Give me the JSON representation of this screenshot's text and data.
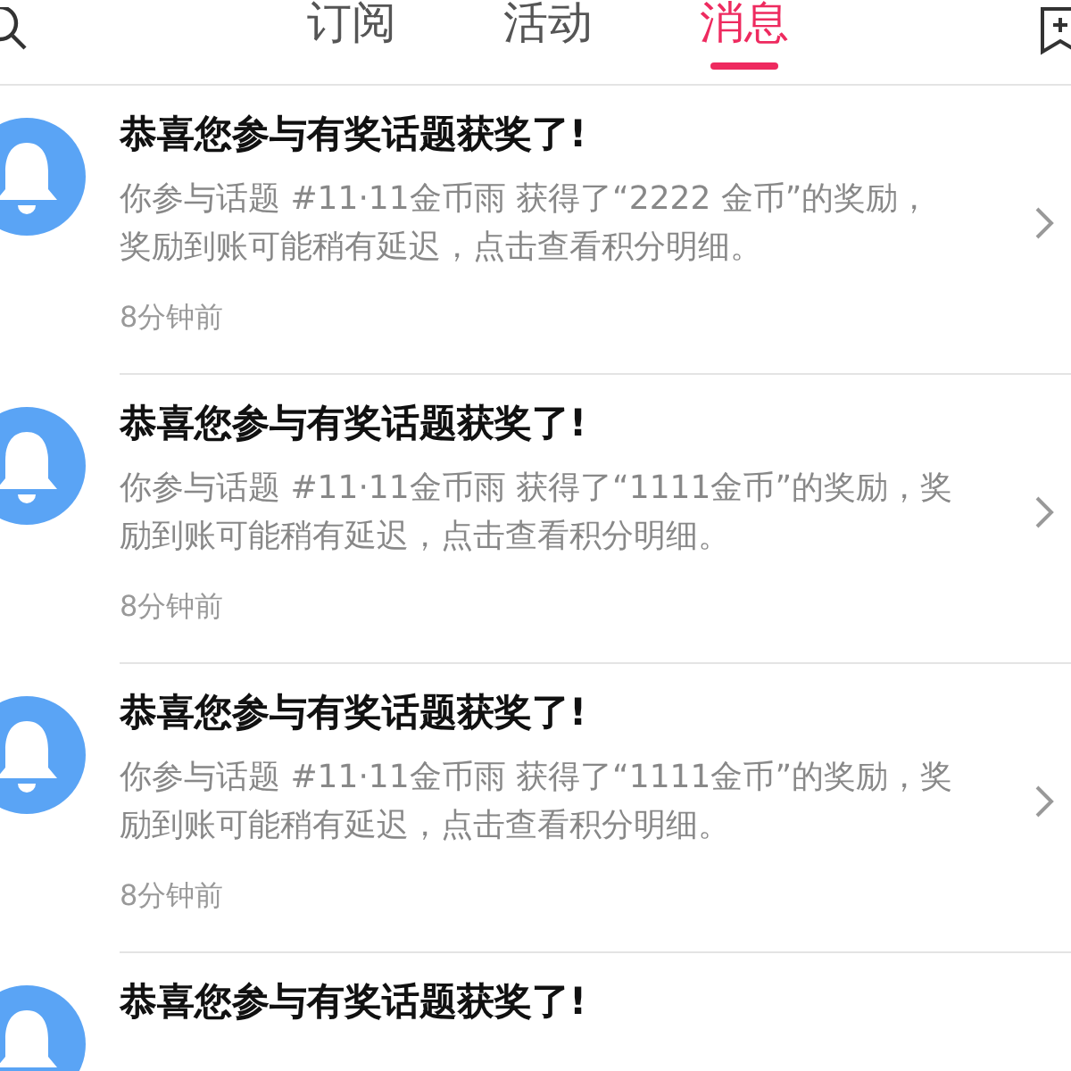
{
  "tabs": [
    {
      "label": "订阅",
      "selected": false
    },
    {
      "label": "活动",
      "selected": false
    },
    {
      "label": "消息",
      "selected": true
    }
  ],
  "messages": [
    {
      "title": "恭喜您参与有奖话题获奖了!",
      "body": "你参与话题 #11·11金币雨 获得了“2222 金币”的奖励，奖励到账可能稍有延迟，点击查看积分明细。",
      "time": "8分钟前"
    },
    {
      "title": "恭喜您参与有奖话题获奖了!",
      "body": "你参与话题 #11·11金币雨 获得了“1111金币”的奖励，奖励到账可能稍有延迟，点击查看积分明细。",
      "time": "8分钟前"
    },
    {
      "title": "恭喜您参与有奖话题获奖了!",
      "body": "你参与话题 #11·11金币雨 获得了“1111金币”的奖励，奖励到账可能稍有延迟，点击查看积分明细。",
      "time": "8分钟前"
    },
    {
      "title": "恭喜您参与有奖话题获奖了!"
    }
  ]
}
